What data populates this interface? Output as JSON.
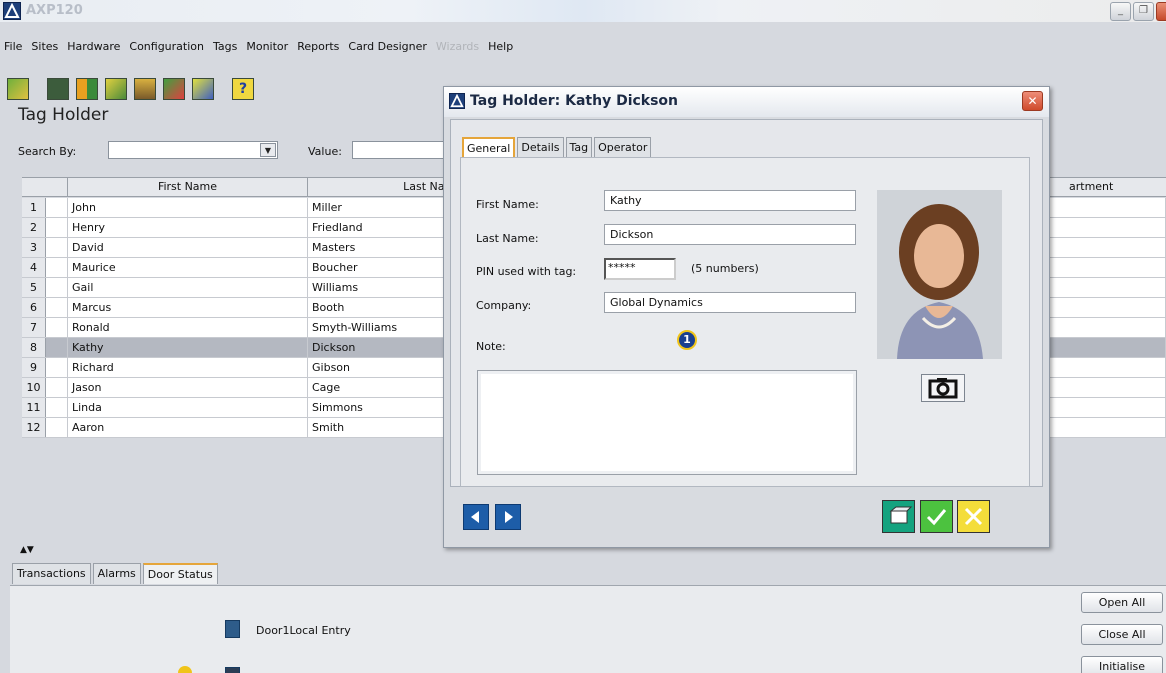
{
  "app": {
    "title": "AXP120",
    "window_buttons": [
      "minimize-icon",
      "restore-icon",
      "close-icon"
    ]
  },
  "menu": [
    "File",
    "Sites",
    "Hardware",
    "Configuration",
    "Tags",
    "Monitor",
    "Reports",
    "Card Designer",
    "Wizards",
    "Help"
  ],
  "menu_disabled": [
    "Wizards"
  ],
  "toolbar_icons": [
    "sites-icon",
    "calculator-icon",
    "doors-icon",
    "schedule-icon",
    "access-icon",
    "report-icon",
    "edit-icon",
    "help-icon"
  ],
  "panel": {
    "title": "Tag Holder",
    "search_by_label": "Search By:",
    "search_by_value": "",
    "value_label": "Value:",
    "value_input": ""
  },
  "grid": {
    "columns": [
      "First Name",
      "Last Name",
      "artment"
    ],
    "selected_index": 7,
    "rows": [
      {
        "num": "1",
        "first": "John",
        "last": "Miller"
      },
      {
        "num": "2",
        "first": "Henry",
        "last": "Friedland"
      },
      {
        "num": "3",
        "first": "David",
        "last": "Masters"
      },
      {
        "num": "4",
        "first": "Maurice",
        "last": "Boucher"
      },
      {
        "num": "5",
        "first": "Gail",
        "last": "Williams"
      },
      {
        "num": "6",
        "first": "Marcus",
        "last": "Booth"
      },
      {
        "num": "7",
        "first": "Ronald",
        "last": "Smyth-Williams"
      },
      {
        "num": "8",
        "first": "Kathy",
        "last": "Dickson"
      },
      {
        "num": "9",
        "first": "Richard",
        "last": "Gibson"
      },
      {
        "num": "10",
        "first": "Jason",
        "last": "Cage"
      },
      {
        "num": "11",
        "first": "Linda",
        "last": "Simmons"
      },
      {
        "num": "12",
        "first": "Aaron",
        "last": "Smith"
      }
    ]
  },
  "bottom_tabs": [
    "Transactions",
    "Alarms",
    "Door Status"
  ],
  "bottom_active_tab": "Door Status",
  "doors": [
    {
      "label": "Door1Local Entry"
    }
  ],
  "door_buttons": [
    "Open All",
    "Close All",
    "Initialise"
  ],
  "dialog": {
    "title": "Tag Holder: Kathy Dickson",
    "tabs": [
      "General",
      "Details",
      "Tag",
      "Operator"
    ],
    "active_tab": "General",
    "fields": {
      "first_name_label": "First Name:",
      "first_name": "Kathy",
      "last_name_label": "Last Name:",
      "last_name": "Dickson",
      "pin_label": "PIN used with tag:",
      "pin": "*****",
      "pin_hint": "(5 numbers)",
      "company_label": "Company:",
      "company": "Global Dynamics",
      "note_label": "Note:",
      "note": ""
    },
    "callout_number": "1",
    "icons": [
      "camera-icon",
      "previous-icon",
      "next-icon",
      "print-card-icon",
      "ok-icon",
      "cancel-icon"
    ],
    "colors": {
      "nav_blue": "#1d5da8",
      "ok_green": "#4cc23f",
      "cancel_yellow": "#f4dd3a",
      "callout_blue": "#1a3f8f"
    }
  }
}
